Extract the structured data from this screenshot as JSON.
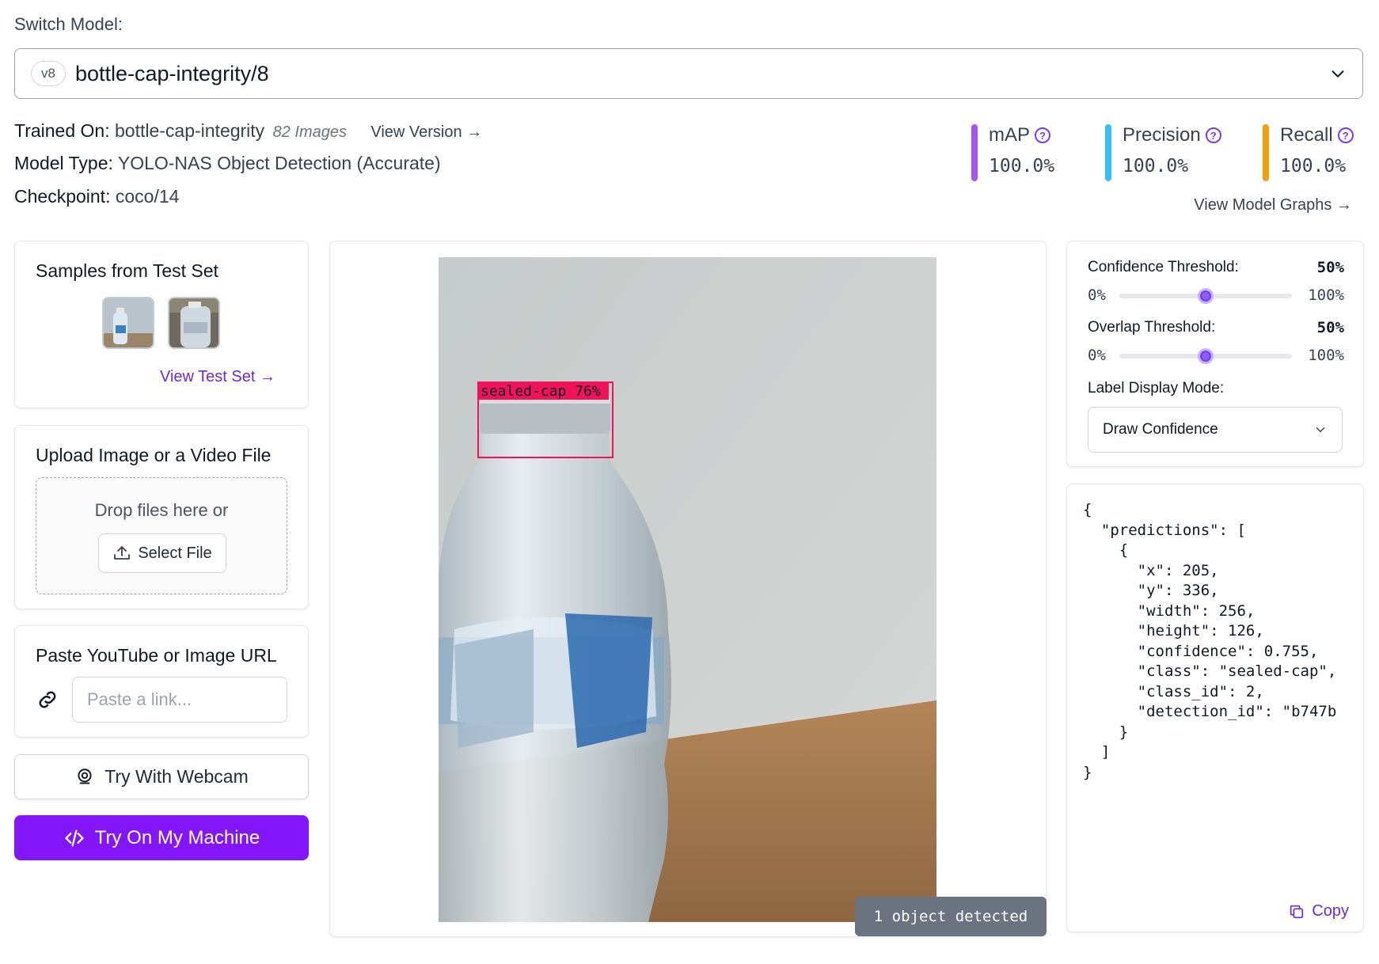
{
  "header": {
    "switch_label": "Switch Model:",
    "version_badge": "v8",
    "model_name": "bottle-cap-integrity/8"
  },
  "meta": {
    "trained_on_key": "Trained On:",
    "trained_on_value": "bottle-cap-integrity",
    "image_count": "82 Images",
    "view_version": "View Version",
    "model_type_key": "Model Type:",
    "model_type_value": "YOLO-NAS Object Detection (Accurate)",
    "checkpoint_key": "Checkpoint:",
    "checkpoint_value": "coco/14"
  },
  "metrics": [
    {
      "name": "mAP",
      "value": "100.0%",
      "color": "#a855f7"
    },
    {
      "name": "Precision",
      "value": "100.0%",
      "color": "#38bdf8"
    },
    {
      "name": "Recall",
      "value": "100.0%",
      "color": "#f59e0b"
    }
  ],
  "view_model_graphs": "View Model Graphs",
  "samples": {
    "title": "Samples from Test Set",
    "view_test_set": "View Test Set"
  },
  "upload": {
    "title": "Upload Image or a Video File",
    "drop_text": "Drop files here or",
    "select_file": "Select File"
  },
  "url": {
    "title": "Paste YouTube or Image URL",
    "placeholder": "Paste a link..."
  },
  "webcam_label": "Try With Webcam",
  "machine_label": "Try On My Machine",
  "preview": {
    "box_label": "sealed-cap 76%",
    "detected": "1 object detected",
    "box_color": "#f0135a"
  },
  "settings": {
    "confidence_label": "Confidence Threshold:",
    "confidence_value": "50%",
    "confidence_fraction": 0.5,
    "overlap_label": "Overlap Threshold:",
    "overlap_value": "50%",
    "overlap_fraction": 0.5,
    "min": "0%",
    "max": "100%",
    "label_mode_label": "Label Display Mode:",
    "label_mode_value": "Draw Confidence"
  },
  "json_output": "{\n  \"predictions\": [\n    {\n      \"x\": 205,\n      \"y\": 336,\n      \"width\": 256,\n      \"height\": 126,\n      \"confidence\": 0.755,\n      \"class\": \"sealed-cap\",\n      \"class_id\": 2,\n      \"detection_id\": \"b747b\n    }\n  ]\n}",
  "copy_label": "Copy",
  "accent_color": "#8315f9"
}
